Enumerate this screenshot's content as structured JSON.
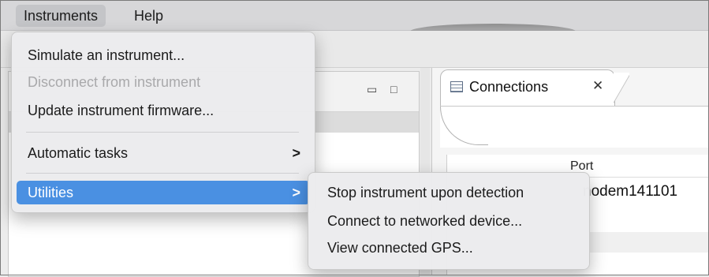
{
  "menubar": {
    "items": [
      {
        "label": "Instruments"
      },
      {
        "label": "Help"
      }
    ]
  },
  "instruments_menu": {
    "items": [
      {
        "label": "Simulate an instrument...",
        "enabled": true
      },
      {
        "label": "Disconnect from instrument",
        "enabled": false
      },
      {
        "label": "Update instrument firmware...",
        "enabled": true
      },
      {
        "label": "Automatic tasks",
        "enabled": true,
        "submenu_indicator": ">"
      },
      {
        "label": "Utilities",
        "enabled": true,
        "highlighted": true,
        "submenu_indicator": ">"
      }
    ]
  },
  "utilities_submenu": {
    "items": [
      {
        "label": "Stop instrument upon detection"
      },
      {
        "label": "Connect to networked device..."
      },
      {
        "label": "View connected GPS..."
      }
    ]
  },
  "connections_view": {
    "tab_label": "Connections",
    "tab_close_glyph": "✕",
    "column_header": "Port",
    "rows": [
      {
        "port": "nodem141101"
      }
    ]
  },
  "left_view": {
    "controls": {
      "minimize": "▭",
      "maximize": "□"
    }
  },
  "colors": {
    "highlight": "#4a90e2",
    "menubar_bg": "#d7d7d9",
    "disabled_text": "#a9a9ab"
  }
}
